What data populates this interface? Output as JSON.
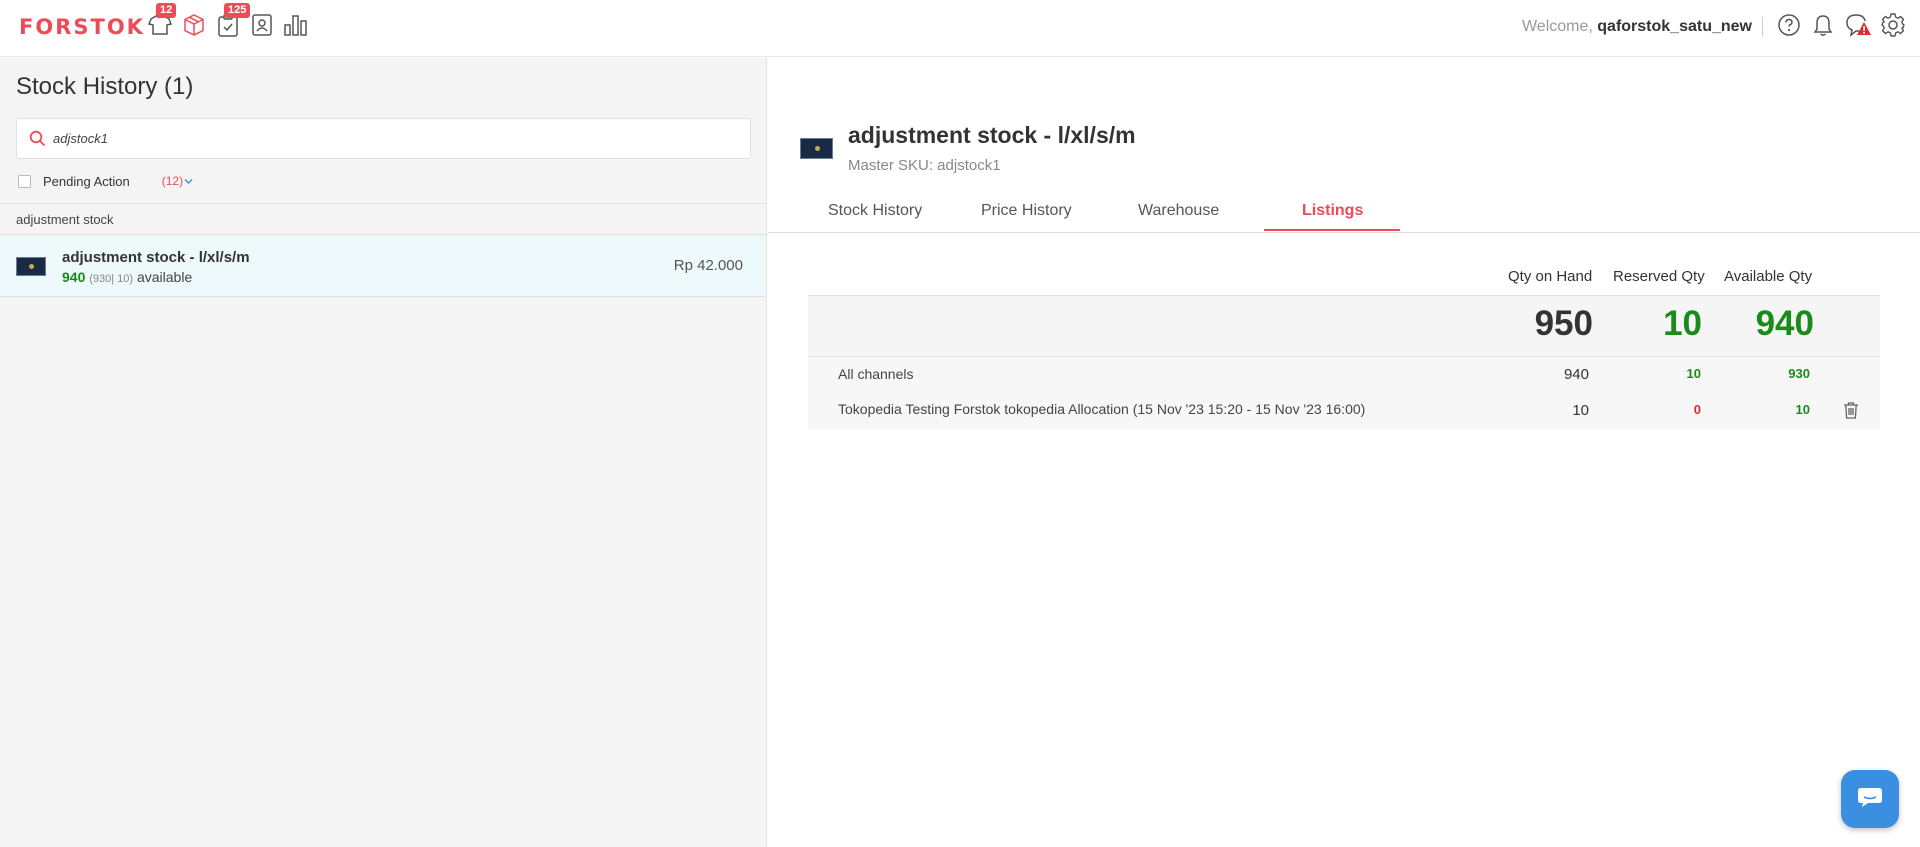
{
  "topbar": {
    "logo": "FORSTOK",
    "badges": {
      "products": "12",
      "orders": "125"
    },
    "welcome_prefix": "Welcome,",
    "username": "qaforstok_satu_new",
    "icons": [
      "shirt-icon",
      "box-icon",
      "clipboard-icon",
      "contact-icon",
      "bar-chart-icon",
      "help-icon",
      "bell-icon",
      "alert-chat-icon",
      "gear-icon"
    ]
  },
  "left": {
    "title": "Stock History",
    "count": "(1)",
    "search_value": "adjstock1",
    "pending_label": "Pending Action",
    "pending_count": "(12)",
    "group_header": "adjustment stock",
    "items": [
      {
        "name": "adjustment stock - l/xl/s/m",
        "available": "940",
        "breakdown": "(930| 10)",
        "available_label": "available",
        "price": "Rp 42.000"
      }
    ]
  },
  "detail": {
    "title": "adjustment stock - l/xl/s/m",
    "sku": "Master SKU: adjstock1",
    "tabs": [
      "Stock History",
      "Price History",
      "Warehouse",
      "Listings"
    ],
    "active_tab": "Listings",
    "columns": {
      "on_hand": "Qty on Hand",
      "reserved": "Reserved Qty",
      "available": "Available Qty"
    },
    "totals": {
      "on_hand": "950",
      "reserved": "10",
      "available": "940"
    },
    "rows": [
      {
        "label": "All channels",
        "on_hand": "940",
        "reserved": "10",
        "available": "930"
      },
      {
        "label": "Tokopedia Testing Forstok tokopedia Allocation (15 Nov '23 15:20 - 15 Nov '23 16:00)",
        "on_hand": "10",
        "reserved": "0",
        "available": "10"
      }
    ]
  },
  "colors": {
    "brand": "#ee4b58",
    "green": "#1a8a1a",
    "chat": "#3a8fe0"
  }
}
